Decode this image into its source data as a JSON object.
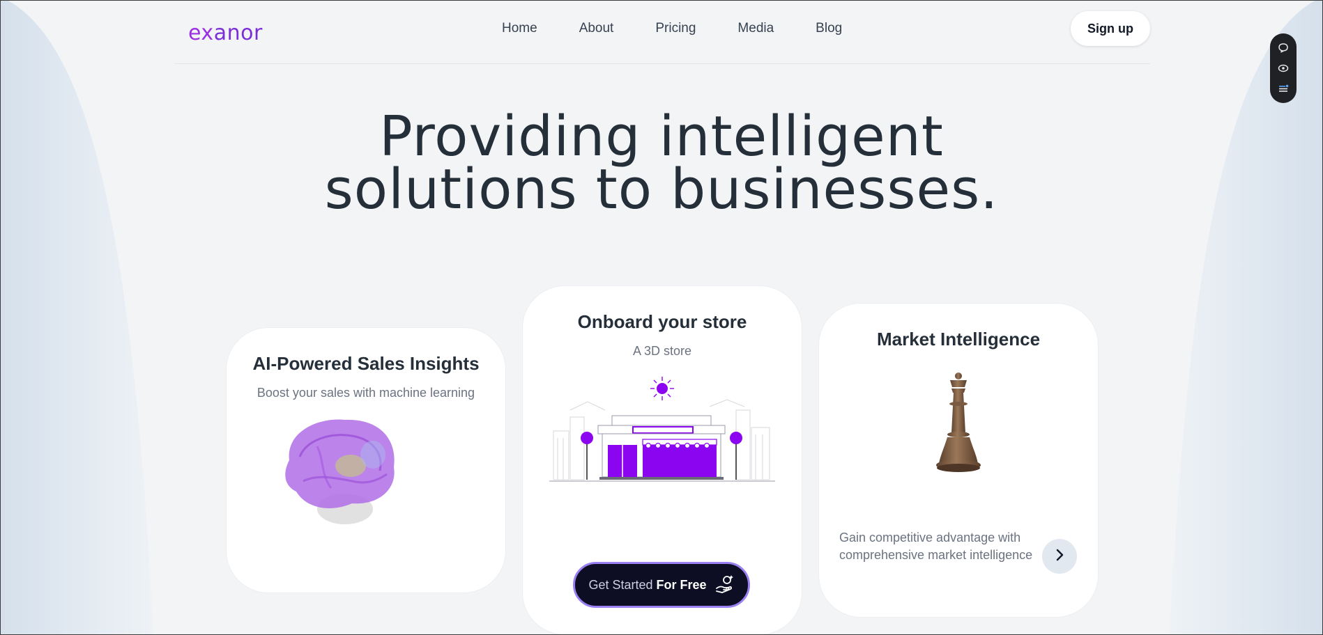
{
  "brand": {
    "logo_prefix": "ex",
    "logo_rest": "anor",
    "accent": "#9b30e0"
  },
  "nav": {
    "links": [
      "Home",
      "About",
      "Pricing",
      "Media",
      "Blog"
    ],
    "signup_label": "Sign up"
  },
  "widget": {
    "icons": [
      "chat-bubble-icon",
      "eye-icon",
      "list-icon"
    ]
  },
  "hero": {
    "line1": "Providing intelligent",
    "line2": "solutions to businesses."
  },
  "cards": [
    {
      "title": "AI-Powered Sales Insights",
      "subtitle": "Boost your sales with machine learning",
      "image": "brain-3d"
    },
    {
      "title": "Onboard your store",
      "subtitle": "A 3D store",
      "image": "storefront-illustration",
      "cta_light": "Get Started",
      "cta_bold": "For Free",
      "cta_icon": "hand-sparkle-icon"
    },
    {
      "title": "Market Intelligence",
      "image": "chess-queen-3d",
      "description": "Gain competitive advantage with comprehensive market intelligence",
      "action_icon": "chevron-right-icon"
    }
  ],
  "colors": {
    "purple": "#8b05f0",
    "dark": "#0d0d23",
    "text": "#252f3a",
    "muted": "#6b7280"
  }
}
